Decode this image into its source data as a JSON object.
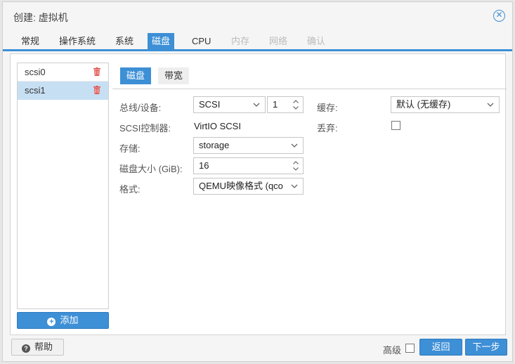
{
  "dialog": {
    "title": "创建: 虚拟机"
  },
  "tabs": [
    {
      "label": "常规",
      "state": "normal"
    },
    {
      "label": "操作系统",
      "state": "normal"
    },
    {
      "label": "系统",
      "state": "normal"
    },
    {
      "label": "磁盘",
      "state": "active"
    },
    {
      "label": "CPU",
      "state": "normal"
    },
    {
      "label": "内存",
      "state": "disabled"
    },
    {
      "label": "网络",
      "state": "disabled"
    },
    {
      "label": "确认",
      "state": "disabled"
    }
  ],
  "disks": {
    "items": [
      {
        "label": "scsi0",
        "selected": false
      },
      {
        "label": "scsi1",
        "selected": true
      }
    ],
    "add_label": "添加"
  },
  "subtabs": [
    {
      "label": "磁盘",
      "active": true
    },
    {
      "label": "带宽",
      "active": false
    }
  ],
  "form": {
    "bus_device": {
      "label": "总线/设备:",
      "bus": "SCSI",
      "device": "1"
    },
    "scsi_controller": {
      "label": "SCSI控制器:",
      "value": "VirtIO SCSI"
    },
    "storage": {
      "label": "存储:",
      "value": "storage"
    },
    "disk_size": {
      "label": "磁盘大小 (GiB):",
      "value": "16"
    },
    "format": {
      "label": "格式:",
      "value": "QEMU映像格式 (qco"
    },
    "cache": {
      "label": "缓存:",
      "value": "默认 (无缓存)"
    },
    "discard": {
      "label": "丢弃:",
      "checked": false
    }
  },
  "footer": {
    "help_label": "帮助",
    "advanced_label": "高级",
    "advanced_checked": false,
    "back_label": "返回",
    "next_label": "下一步"
  },
  "colors": {
    "accent": "#3d8fd6",
    "selected_row": "#c7dff3",
    "trash": "#e2504c"
  }
}
